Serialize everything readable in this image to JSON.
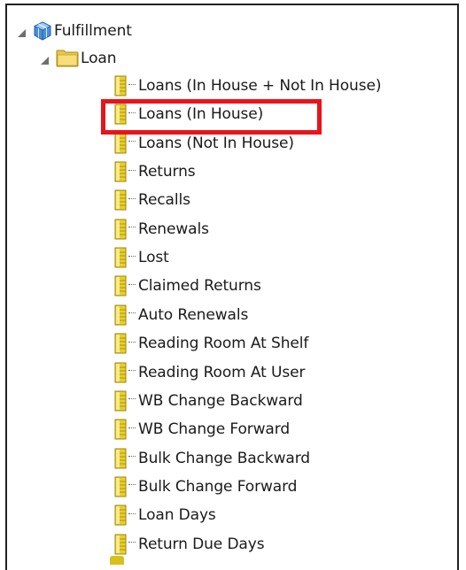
{
  "tree": {
    "root": {
      "label": "Fulfillment",
      "icon": "cube-icon"
    },
    "folder": {
      "label": "Loan",
      "icon": "folder-icon"
    },
    "items": [
      {
        "label": "Loans (In House + Not In House)"
      },
      {
        "label": "Loans (In House)"
      },
      {
        "label": "Loans (Not In House)"
      },
      {
        "label": "Returns"
      },
      {
        "label": "Recalls"
      },
      {
        "label": "Renewals"
      },
      {
        "label": "Lost"
      },
      {
        "label": "Claimed Returns"
      },
      {
        "label": "Auto Renewals"
      },
      {
        "label": "Reading Room At Shelf"
      },
      {
        "label": "Reading Room At User"
      },
      {
        "label": "WB Change Backward"
      },
      {
        "label": "WB Change Forward"
      },
      {
        "label": "Bulk Change Backward"
      },
      {
        "label": "Bulk Change Forward"
      },
      {
        "label": "Loan Days"
      },
      {
        "label": "Return Due Days"
      }
    ]
  },
  "colors": {
    "highlight": "#e8141b",
    "column_icon": "#d9bf1c",
    "folder": "#e8c84a",
    "cube": "#4a8fd8"
  }
}
